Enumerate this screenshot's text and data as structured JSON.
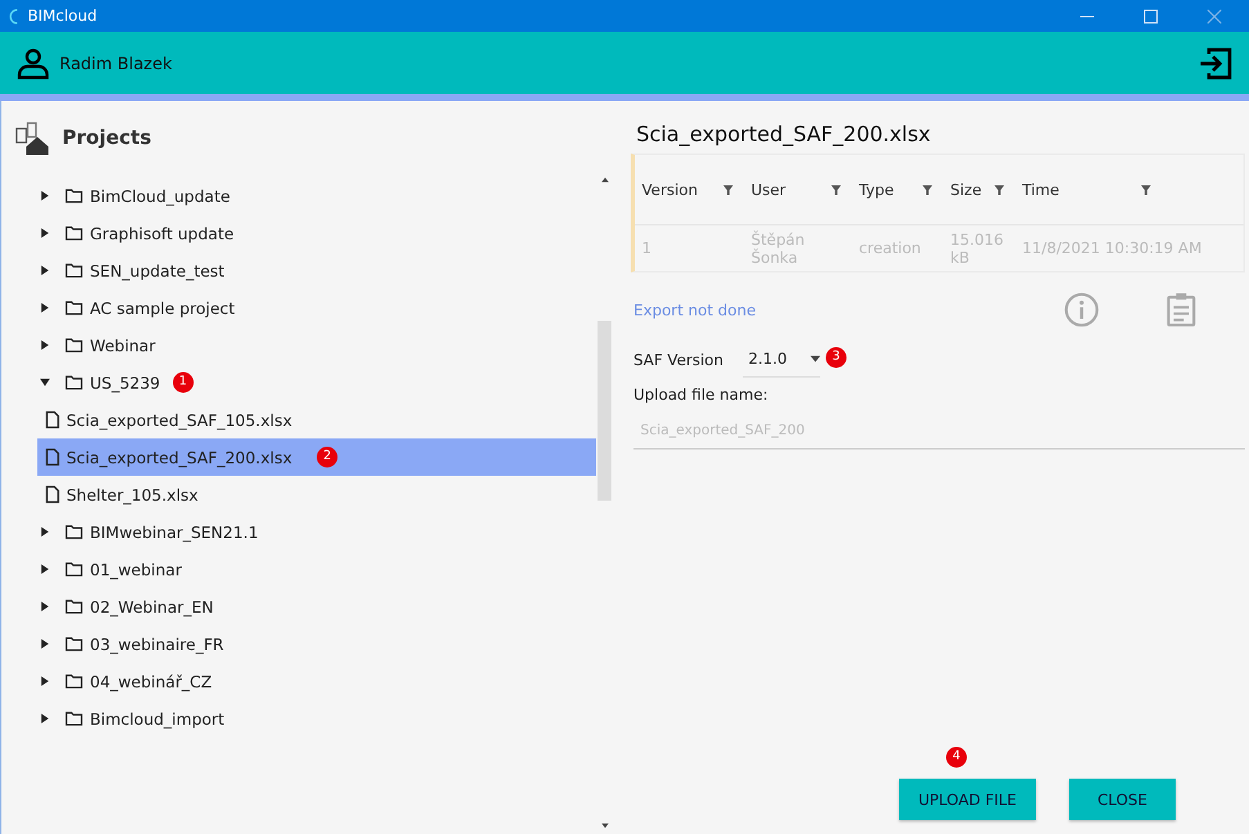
{
  "window": {
    "title": "BIMcloud"
  },
  "user": {
    "name": "Radim Blazek"
  },
  "projects": {
    "title": "Projects",
    "tree": [
      {
        "kind": "folder",
        "label": "BimCloud_update",
        "expanded": false,
        "selected": false
      },
      {
        "kind": "folder",
        "label": "Graphisoft update",
        "expanded": false,
        "selected": false
      },
      {
        "kind": "folder",
        "label": "SEN_update_test",
        "expanded": false,
        "selected": false
      },
      {
        "kind": "folder",
        "label": "AC sample project",
        "expanded": false,
        "selected": false
      },
      {
        "kind": "folder",
        "label": "Webinar",
        "expanded": false,
        "selected": false
      },
      {
        "kind": "folder",
        "label": "US_5239",
        "expanded": true,
        "selected": false,
        "badge": "1",
        "children": [
          {
            "kind": "file",
            "label": "Scia_exported_SAF_105.xlsx",
            "selected": false
          },
          {
            "kind": "file",
            "label": "Scia_exported_SAF_200.xlsx",
            "selected": true,
            "badge": "2"
          },
          {
            "kind": "file",
            "label": "Shelter_105.xlsx",
            "selected": false
          }
        ]
      },
      {
        "kind": "folder",
        "label": "BIMwebinar_SEN21.1",
        "expanded": false,
        "selected": false
      },
      {
        "kind": "folder",
        "label": "01_webinar",
        "expanded": false,
        "selected": false
      },
      {
        "kind": "folder",
        "label": "02_Webinar_EN",
        "expanded": false,
        "selected": false
      },
      {
        "kind": "folder",
        "label": "03_webinaire_FR",
        "expanded": false,
        "selected": false
      },
      {
        "kind": "folder",
        "label": "04_webinář_CZ",
        "expanded": false,
        "selected": false
      },
      {
        "kind": "folder",
        "label": "Bimcloud_import",
        "expanded": false,
        "selected": false
      }
    ]
  },
  "detail": {
    "title": "Scia_exported_SAF_200.xlsx",
    "table": {
      "columns": [
        "Version",
        "User",
        "Type",
        "Size",
        "Time"
      ],
      "rows": [
        [
          "1",
          "Štěpán Šonka",
          "creation",
          "15.016 kB",
          "11/8/2021 10:30:19 AM"
        ]
      ]
    },
    "export_status": "Export not done",
    "saf_version": {
      "label": "SAF Version",
      "value": "2.1.0",
      "badge": "3"
    },
    "upload_name": {
      "label": "Upload file name:",
      "placeholder": "Scia_exported_SAF_200"
    }
  },
  "buttons": [
    {
      "label": "UPLOAD FILE",
      "badge": "4"
    },
    {
      "label": "CLOSE"
    }
  ]
}
